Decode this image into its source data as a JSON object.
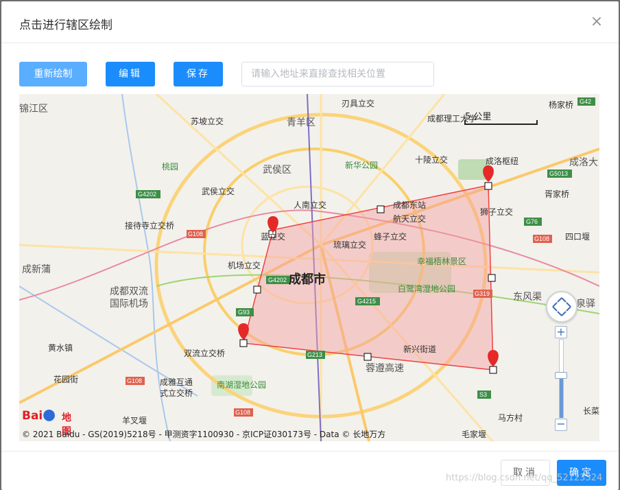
{
  "dialog": {
    "title": "点击进行辖区绘制",
    "close_glyph": "×"
  },
  "toolbar": {
    "redraw_label": "重新绘制",
    "edit_label": "编辑",
    "save_label": "保存",
    "search_placeholder": "请输入地址来直接查找相关位置"
  },
  "map": {
    "scale_label": "5 公里",
    "copyright": "© 2021 Baidu - GS(2019)5218号 - 甲测资字1100930 - 京ICP证030173号 - Data © 长地万方",
    "logo_text": "Bai",
    "logo_cn": "地图",
    "city_label": "成都市",
    "place_labels": [
      "刃具立交",
      "苏坡立交",
      "青羊区",
      "成都理工大学",
      "武侯区",
      "新华公园",
      "十陵立交",
      "成洛枢纽",
      "成洛大",
      "桃园",
      "武侯立交",
      "人南立交",
      "成都东站",
      "狮子立交",
      "接待寺立交桥",
      "蓝立交",
      "航天立交",
      "胥家桥",
      "蜂子立交",
      "琉璃立交",
      "四口堰",
      "机场立交",
      "幸福梧林景区",
      "成都双流国际机场",
      "白鹭湾湿地公园",
      "东风渠",
      "泉驿",
      "黄水镇",
      "双流立交桥",
      "新兴街道",
      "花园街",
      "成雅互通式立交桥",
      "南湖湿地公园",
      "蓉遵高速",
      "马方村",
      "羊叉堰",
      "长菜",
      "毛家堰",
      "杨家桥",
      "锦江区",
      "成新蒲"
    ],
    "highway_badges": [
      "G42",
      "G5013",
      "G4202",
      "G76",
      "G108",
      "G4202",
      "G4215",
      "G319",
      "G93",
      "G213",
      "G108",
      "S3",
      "G108",
      "G108"
    ],
    "polygon_color": "#f04040",
    "fill_color": "#f5a0a0",
    "marker_color": "#e52828"
  },
  "footer": {
    "cancel_label": "取消",
    "ok_label": "确定",
    "watermark": "https://blog.csdn.net/qq_52123324"
  }
}
